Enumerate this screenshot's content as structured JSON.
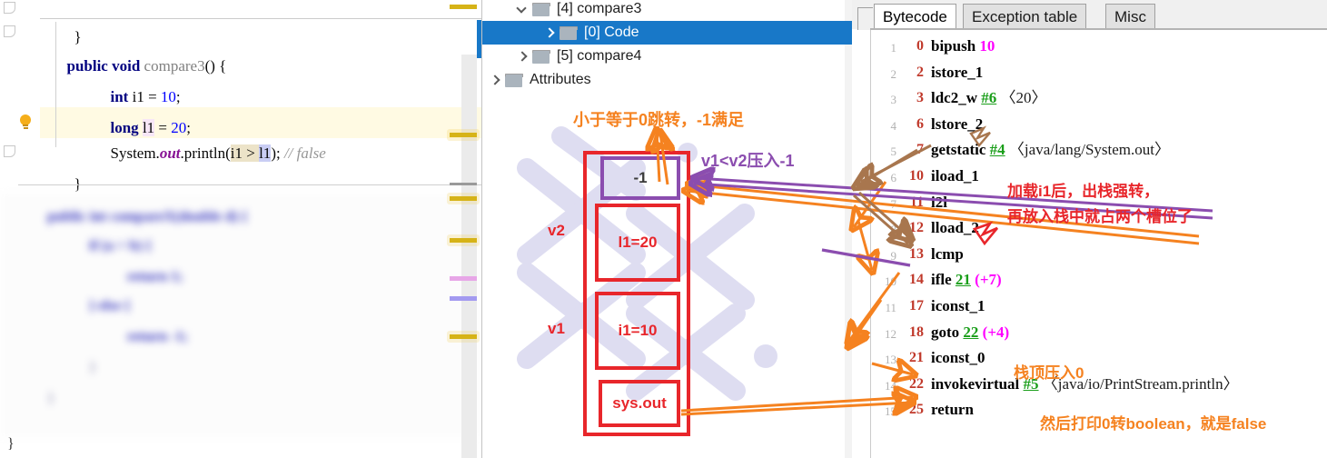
{
  "editor": {
    "lines": [
      {
        "id": "l1",
        "text": "}"
      },
      {
        "id": "l2",
        "text": "public void compare3() {"
      },
      {
        "id": "l3",
        "text": "int i1 = 10;"
      },
      {
        "id": "l4",
        "text": "long l1 = 20;"
      },
      {
        "id": "l5",
        "text": "System.out.println(i1 > l1); // false"
      },
      {
        "id": "l6",
        "text": "}"
      }
    ],
    "tokens": {
      "close_brace": "}",
      "kw_public": "public",
      "kw_void": "void",
      "method_compare3": "compare3",
      "parens": "() {",
      "kw_int": "int",
      "var_i1": "i1",
      "eq": " = ",
      "num_10": "10",
      "semi": ";",
      "kw_long": "long",
      "var_l1": "l1",
      "num_20": "20",
      "sys": "System.",
      "out": "out",
      "println": ".println(",
      "cmp_i1": "i1",
      "cmp_op": " > ",
      "cmp_l1": "l1",
      "close_call": ");",
      "comment": "// false"
    },
    "lightbulb": "lightbulb-intention-icon"
  },
  "tree": {
    "items": [
      {
        "label": "[4] compare3",
        "indent": 30,
        "expanded": true,
        "selected": false
      },
      {
        "label": "[0] Code",
        "indent": 60,
        "expanded": false,
        "selected": true
      },
      {
        "label": "[5] compare4",
        "indent": 30,
        "expanded": false,
        "selected": false
      },
      {
        "label": "Attributes",
        "indent": 2,
        "expanded": false,
        "selected": false
      }
    ]
  },
  "bytecode": {
    "tabs": [
      {
        "label": "Bytecode",
        "active": true
      },
      {
        "label": "Exception table",
        "active": false
      },
      {
        "label": "Misc",
        "active": false
      }
    ],
    "instructions": [
      {
        "no": "1",
        "offset": "0",
        "op": "bipush",
        "arg": "10",
        "argtype": "lit",
        "detail": ""
      },
      {
        "no": "2",
        "offset": "2",
        "op": "istore_1",
        "arg": "",
        "argtype": "",
        "detail": ""
      },
      {
        "no": "3",
        "offset": "3",
        "op": "ldc2_w",
        "arg": "#6",
        "argtype": "cp",
        "detail": "〈20〉"
      },
      {
        "no": "4",
        "offset": "6",
        "op": "lstore_2",
        "arg": "",
        "argtype": "",
        "detail": ""
      },
      {
        "no": "5",
        "offset": "7",
        "op": "getstatic",
        "arg": "#4",
        "argtype": "cp",
        "detail": "〈java/lang/System.out〉"
      },
      {
        "no": "6",
        "offset": "10",
        "op": "iload_1",
        "arg": "",
        "argtype": "",
        "detail": ""
      },
      {
        "no": "7",
        "offset": "11",
        "op": "i2l",
        "arg": "",
        "argtype": "",
        "detail": ""
      },
      {
        "no": "8",
        "offset": "12",
        "op": "lload_2",
        "arg": "",
        "argtype": "",
        "detail": ""
      },
      {
        "no": "9",
        "offset": "13",
        "op": "lcmp",
        "arg": "",
        "argtype": "",
        "detail": ""
      },
      {
        "no": "10",
        "offset": "14",
        "op": "ifle",
        "arg": "21",
        "argtype": "cp",
        "detail": "(+7)"
      },
      {
        "no": "11",
        "offset": "17",
        "op": "iconst_1",
        "arg": "",
        "argtype": "",
        "detail": ""
      },
      {
        "no": "12",
        "offset": "18",
        "op": "goto",
        "arg": "22",
        "argtype": "cp",
        "detail": "(+4)"
      },
      {
        "no": "13",
        "offset": "21",
        "op": "iconst_0",
        "arg": "",
        "argtype": "",
        "detail": ""
      },
      {
        "no": "14",
        "offset": "22",
        "op": "invokevirtual",
        "arg": "#5",
        "argtype": "cp",
        "detail": "〈java/io/PrintStream.println〉"
      },
      {
        "no": "15",
        "offset": "25",
        "op": "return",
        "arg": "",
        "argtype": "",
        "detail": ""
      }
    ]
  },
  "diagram": {
    "title_note": "小于等于0跳转，-1满足",
    "push_note": "v1<v2压入-1",
    "slots": [
      {
        "name": "result-slot",
        "text": "-1",
        "style": "purple"
      },
      {
        "name": "l1-slot",
        "text": "l1=20",
        "style": "red"
      },
      {
        "name": "i1-slot",
        "text": "i1=10",
        "style": "red"
      },
      {
        "name": "sysout-slot",
        "text": "sys.out",
        "style": "red"
      }
    ],
    "v2_label": "v2",
    "v1_label": "v1"
  },
  "annotations": {
    "iload_note_line1": "加载i1后，出栈强转，",
    "iload_note_line2": "再放入栈中就占两个槽位了",
    "iconst0_note": "栈顶压入0",
    "return_note": "然后打印0转boolean，就是false"
  },
  "colors": {
    "orange": "#F58220",
    "red": "#E8262B",
    "purple": "#8B4DAF",
    "brown": "#A8764E",
    "selection_blue": "#1878C8",
    "cp_green": "#1A9E1A",
    "magenta": "#FF00FF"
  }
}
